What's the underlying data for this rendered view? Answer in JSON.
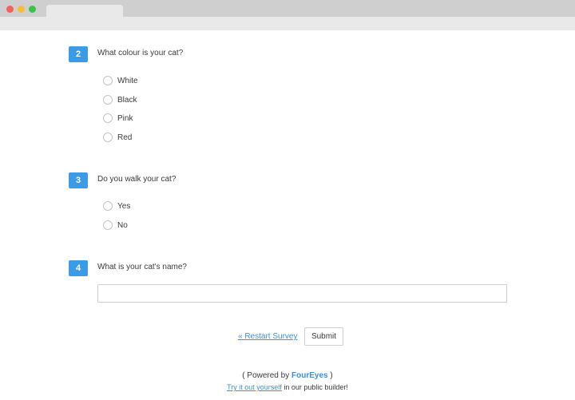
{
  "questions": [
    {
      "number": "2",
      "text": "What colour is your cat?",
      "options": [
        "White",
        "Black",
        "Pink",
        "Red"
      ]
    },
    {
      "number": "3",
      "text": "Do you walk your cat?",
      "options": [
        "Yes",
        "No"
      ]
    },
    {
      "number": "4",
      "text": "What is your cat's name?",
      "input_value": ""
    }
  ],
  "actions": {
    "restart_label": "« Restart Survey",
    "submit_label": "Submit"
  },
  "footer": {
    "powered_prefix": "( Powered by ",
    "brand": "FourEyes",
    "powered_suffix": " )",
    "try_link": "Try it out yourself",
    "try_suffix": " in our public builder!"
  },
  "colors": {
    "accent": "#3b9be6",
    "link": "#3b8fd6"
  }
}
